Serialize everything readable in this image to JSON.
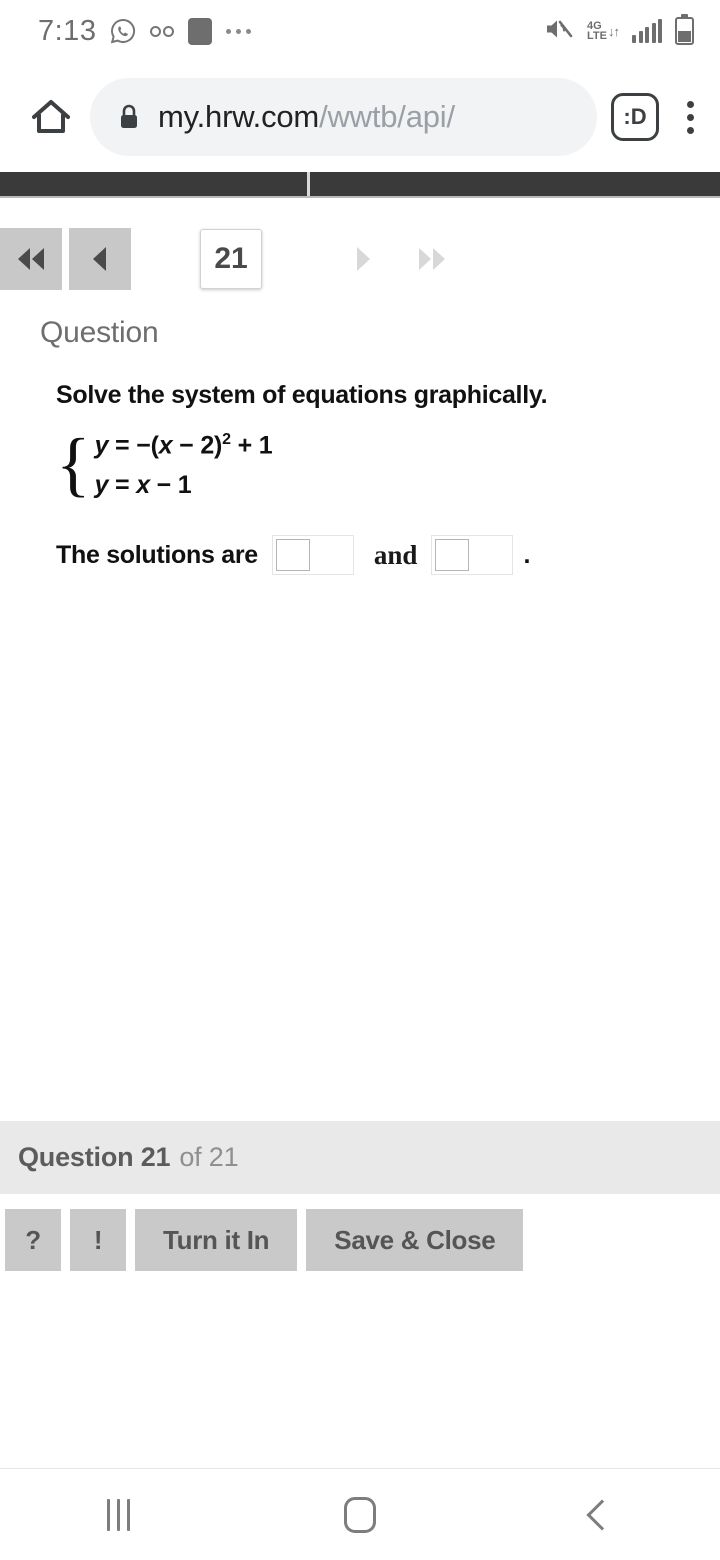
{
  "status_bar": {
    "time": "7:13",
    "left_icons": [
      "whatsapp-icon",
      "voicemail-icon",
      "app-notification-icon",
      "more-notifications-icon"
    ],
    "network_label_top": "4G",
    "network_label_bottom": "LTE",
    "data_arrows": "↓↑",
    "right_icons": [
      "mute-icon",
      "lte-icon",
      "signal-icon",
      "battery-icon"
    ]
  },
  "browser": {
    "home_icon": "home-icon",
    "lock_icon": "lock-icon",
    "url_domain": "my.hrw.com",
    "url_path": "/wwtb/api/",
    "emoji_badge_label": ":D",
    "menu_icon": "kebab-menu-icon"
  },
  "pager": {
    "first_label": "◀◀",
    "prev_label": "◀",
    "page_value": "21",
    "next_label": "▶",
    "last_label": "▶▶"
  },
  "question": {
    "heading": "Question",
    "prompt": "Solve the system of equations graphically.",
    "equation_1_parts": {
      "lhs": "y",
      "eq": " = ",
      "neg": "−(",
      "var": "x",
      "minus_two": " − 2)",
      "power": "2",
      "plus_one": " + 1"
    },
    "equation_2_parts": {
      "lhs": "y",
      "eq": " = ",
      "var": "x",
      "minus_one": " − 1"
    },
    "answer_label": "The solutions are",
    "conjunction": "and",
    "period": ".",
    "answer_1_value": "",
    "answer_2_value": "",
    "answer_placeholder": ""
  },
  "footer": {
    "current": "Question 21",
    "total": "of 21"
  },
  "actions": {
    "help_label": "?",
    "alert_label": "!",
    "turn_in_label": "Turn it In",
    "save_close_label": "Save & Close"
  },
  "android_nav": {
    "recents": "recents-icon",
    "home": "home-icon",
    "back": "back-icon"
  },
  "colors": {
    "dark_strip": "#3a3a3a",
    "button_gray": "#c9c9c9",
    "footer_gray": "#e9e9e9",
    "url_pill": "#f1f3f4"
  }
}
